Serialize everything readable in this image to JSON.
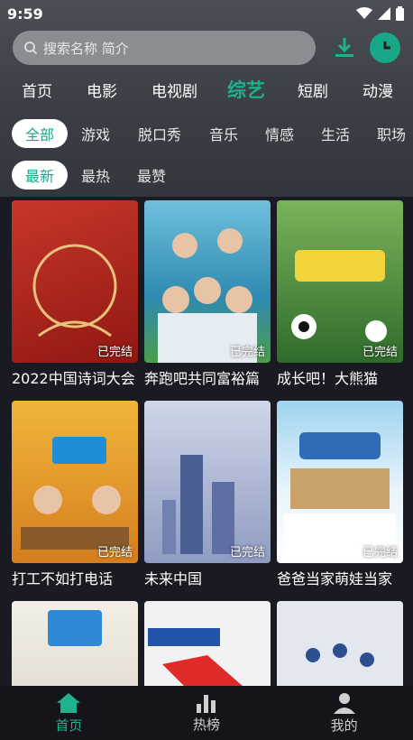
{
  "status_bar": {
    "time": "9:59"
  },
  "search": {
    "placeholder": "搜索名称 简介"
  },
  "category_tabs": [
    {
      "label": "首页",
      "active": false
    },
    {
      "label": "电影",
      "active": false
    },
    {
      "label": "电视剧",
      "active": false
    },
    {
      "label": "综艺",
      "active": true
    },
    {
      "label": "短剧",
      "active": false
    },
    {
      "label": "动漫",
      "active": false
    }
  ],
  "genre_filters": [
    {
      "label": "全部",
      "active": true
    },
    {
      "label": "游戏",
      "active": false
    },
    {
      "label": "脱口秀",
      "active": false
    },
    {
      "label": "音乐",
      "active": false
    },
    {
      "label": "情感",
      "active": false
    },
    {
      "label": "生活",
      "active": false
    },
    {
      "label": "职场",
      "active": false
    }
  ],
  "sort_filters": [
    {
      "label": "最新",
      "active": true
    },
    {
      "label": "最热",
      "active": false
    },
    {
      "label": "最赞",
      "active": false
    }
  ],
  "cards": [
    {
      "title": "2022中国诗词大会",
      "badge": "已完结",
      "color": "#b8261f"
    },
    {
      "title": "奔跑吧共同富裕篇",
      "badge": "已完结",
      "color": "#4fa6c7"
    },
    {
      "title": "成长吧！大熊猫",
      "badge": "已完结",
      "color": "#3f7e3a"
    },
    {
      "title": "打工不如打电话",
      "badge": "已完结",
      "color": "#e0a023"
    },
    {
      "title": "未来中国",
      "badge": "已完结",
      "color": "#6f7fa6"
    },
    {
      "title": "爸爸当家萌娃当家",
      "badge": "已完结",
      "color": "#7cc3e3"
    },
    {
      "title": "",
      "badge": "",
      "color": "#e9e3d6"
    },
    {
      "title": "",
      "badge": "",
      "color": "#e7e7ea"
    },
    {
      "title": "",
      "badge": "",
      "color": "#dfe3ee"
    }
  ],
  "bottom_nav": [
    {
      "label": "首页",
      "icon": "home-icon",
      "active": true
    },
    {
      "label": "热榜",
      "icon": "chart-icon",
      "active": false
    },
    {
      "label": "我的",
      "icon": "user-icon",
      "active": false
    }
  ],
  "colors": {
    "accent": "#1fb08e"
  }
}
